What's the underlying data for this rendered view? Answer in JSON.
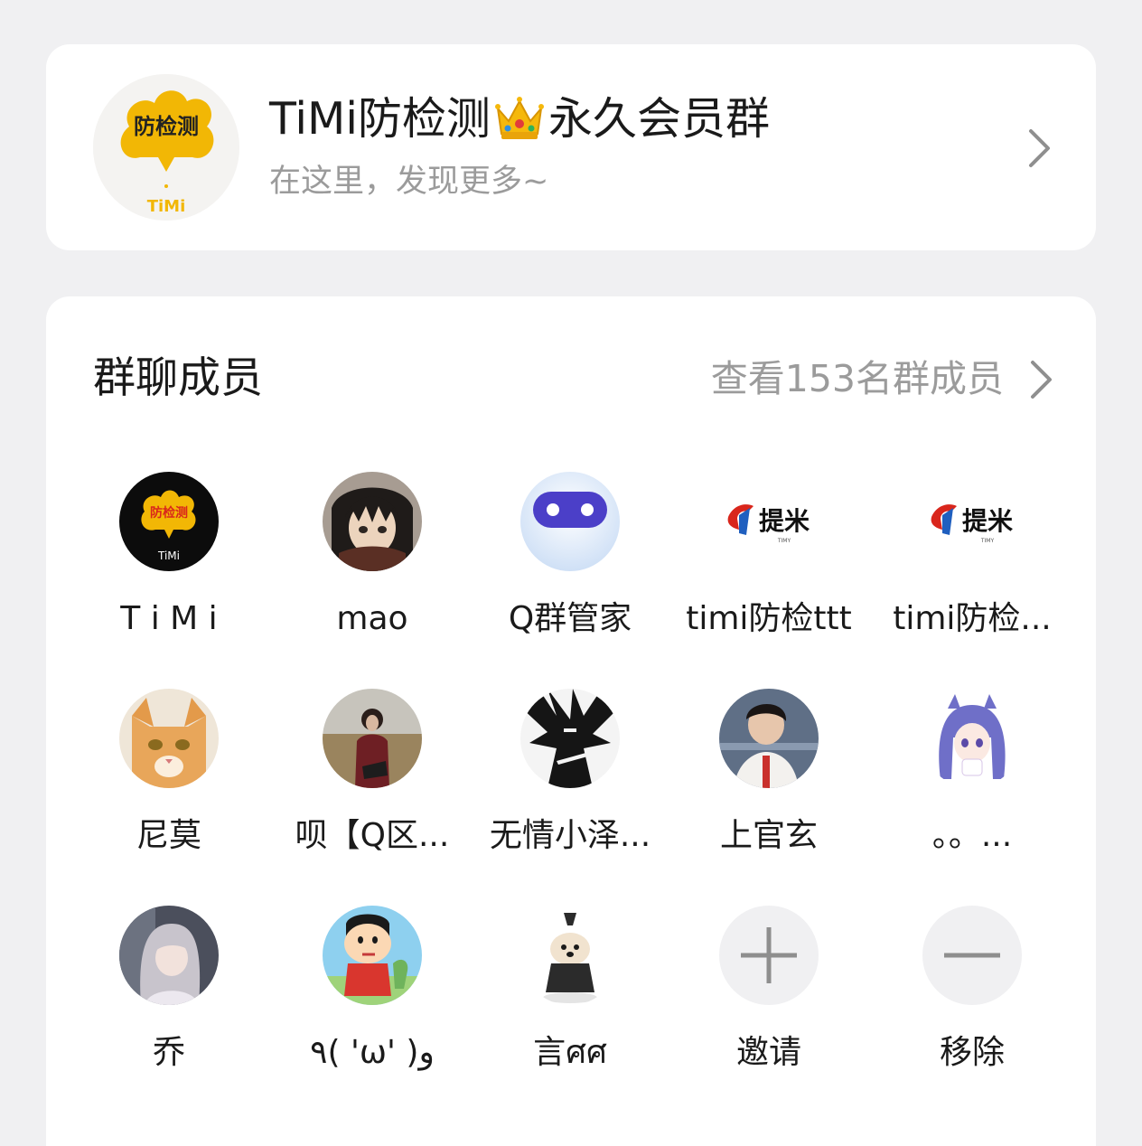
{
  "group": {
    "title_prefix": "TiMi防检测",
    "title_suffix": "永久会员群",
    "subtitle": "在这里，发现更多~",
    "avatar_text": "防检测",
    "avatar_subtext": "TiMi"
  },
  "members_section": {
    "title": "群聊成员",
    "view_all": "查看153名群成员"
  },
  "members": [
    {
      "name": "T i M i",
      "avatar": "timi-logo-avatar"
    },
    {
      "name": "mao",
      "avatar": "anime-avatar"
    },
    {
      "name": "Q群管家",
      "avatar": "bot-avatar"
    },
    {
      "name": "timi防检ttt",
      "avatar": "timi-brand-avatar"
    },
    {
      "name": "timi防检...",
      "avatar": "timi-brand-avatar"
    },
    {
      "name": "尼莫",
      "avatar": "cat-avatar"
    },
    {
      "name": "呗【Q区...",
      "avatar": "photo-avatar"
    },
    {
      "name": "无情小泽...",
      "avatar": "manga-avatar"
    },
    {
      "name": "上官玄",
      "avatar": "portrait-avatar"
    },
    {
      "name": "。。...",
      "avatar": "anime-girl-avatar"
    },
    {
      "name": "乔",
      "avatar": "anime-girl-avatar"
    },
    {
      "name": "٩( 'ω' )و",
      "avatar": "cartoon-avatar"
    },
    {
      "name": "言ศศ",
      "avatar": "toy-avatar"
    },
    {
      "name": "邀请",
      "avatar": "plus-icon"
    },
    {
      "name": "移除",
      "avatar": "minus-icon"
    }
  ],
  "brand_text": "提米",
  "brand_small": "TIMY",
  "colors": {
    "background": "#f0f0f2",
    "card": "#ffffff",
    "text_primary": "#1a1a1a",
    "text_secondary": "#9b9b9b",
    "logo_yellow": "#f2b705",
    "brand_red": "#d9261c"
  }
}
